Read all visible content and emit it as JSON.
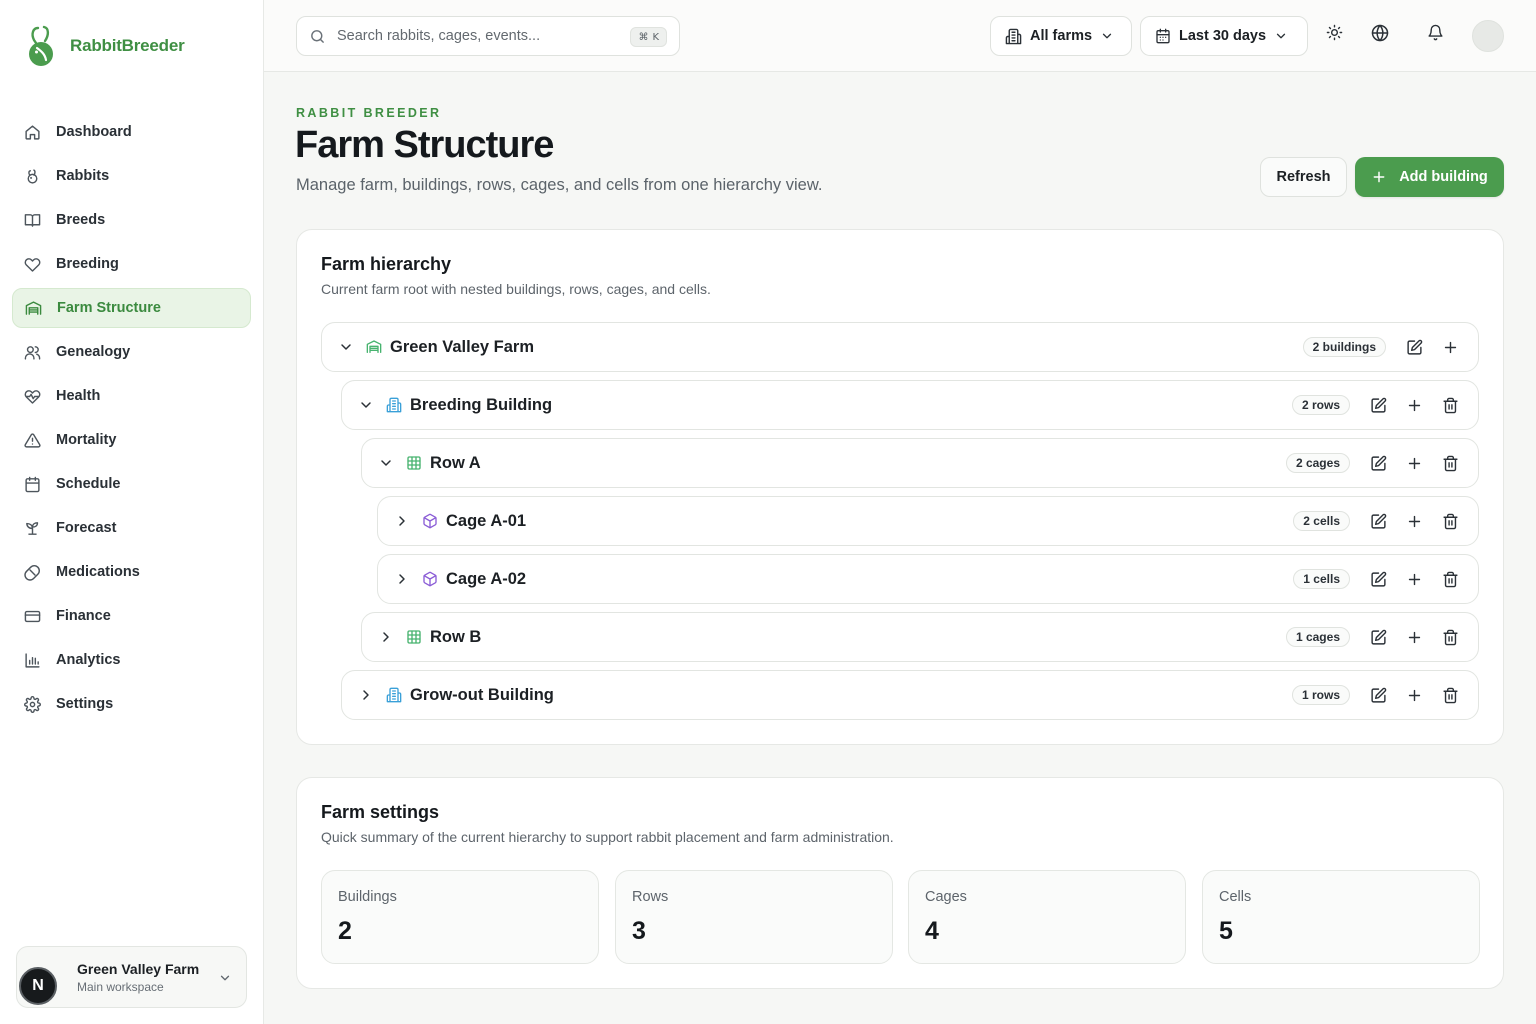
{
  "app": {
    "name": "RabbitBreeder"
  },
  "colors": {
    "brand": "#3f8f43",
    "primary_button": "#4b9c4e",
    "active_nav_bg": "#e9f4e6",
    "building_icon": "#3aa0d8",
    "row_icon": "#47b36f",
    "cage_icon": "#8a5cd6"
  },
  "sidebar": {
    "items": [
      {
        "label": "Dashboard",
        "icon": "home-icon"
      },
      {
        "label": "Rabbits",
        "icon": "rabbit-icon"
      },
      {
        "label": "Breeds",
        "icon": "book-icon"
      },
      {
        "label": "Breeding",
        "icon": "heart-icon"
      },
      {
        "label": "Farm Structure",
        "icon": "warehouse-icon",
        "active": true
      },
      {
        "label": "Genealogy",
        "icon": "users-icon"
      },
      {
        "label": "Health",
        "icon": "heart-pulse-icon"
      },
      {
        "label": "Mortality",
        "icon": "alert-triangle-icon"
      },
      {
        "label": "Schedule",
        "icon": "calendar-icon"
      },
      {
        "label": "Forecast",
        "icon": "sprout-icon"
      },
      {
        "label": "Medications",
        "icon": "pill-icon"
      },
      {
        "label": "Finance",
        "icon": "credit-card-icon"
      },
      {
        "label": "Analytics",
        "icon": "bar-chart-icon"
      },
      {
        "label": "Settings",
        "icon": "gear-icon"
      }
    ],
    "workspace": {
      "avatar_letter": "N",
      "name": "Green Valley Farm",
      "subtitle": "Main workspace"
    }
  },
  "topbar": {
    "search_placeholder": "Search rabbits, cages, events...",
    "shortcut": "K",
    "farm_filter": "All farms",
    "date_range": "Last 30 days"
  },
  "header": {
    "eyebrow": "RABBIT BREEDER",
    "title": "Farm Structure",
    "subtitle": "Manage farm, buildings, rows, cages, and cells from one hierarchy view.",
    "refresh_label": "Refresh",
    "add_label": "Add building"
  },
  "hierarchy": {
    "title": "Farm hierarchy",
    "subtitle": "Current farm root with nested buildings, rows, cages, and cells.",
    "nodes": [
      {
        "label": "Green Valley Farm",
        "badge": "2 buildings",
        "type": "farm",
        "expanded": true
      },
      {
        "label": "Breeding Building",
        "badge": "2 rows",
        "type": "building",
        "expanded": true
      },
      {
        "label": "Row A",
        "badge": "2 cages",
        "type": "row",
        "expanded": true
      },
      {
        "label": "Cage A-01",
        "badge": "2 cells",
        "type": "cage",
        "expanded": false
      },
      {
        "label": "Cage A-02",
        "badge": "1 cells",
        "type": "cage",
        "expanded": false
      },
      {
        "label": "Row B",
        "badge": "1 cages",
        "type": "row",
        "expanded": false
      },
      {
        "label": "Grow-out Building",
        "badge": "1 rows",
        "type": "building",
        "expanded": false
      }
    ]
  },
  "settings": {
    "title": "Farm settings",
    "subtitle": "Quick summary of the current hierarchy to support rabbit placement and farm administration.",
    "stats": [
      {
        "label": "Buildings",
        "value": "2"
      },
      {
        "label": "Rows",
        "value": "3"
      },
      {
        "label": "Cages",
        "value": "4"
      },
      {
        "label": "Cells",
        "value": "5"
      }
    ]
  }
}
